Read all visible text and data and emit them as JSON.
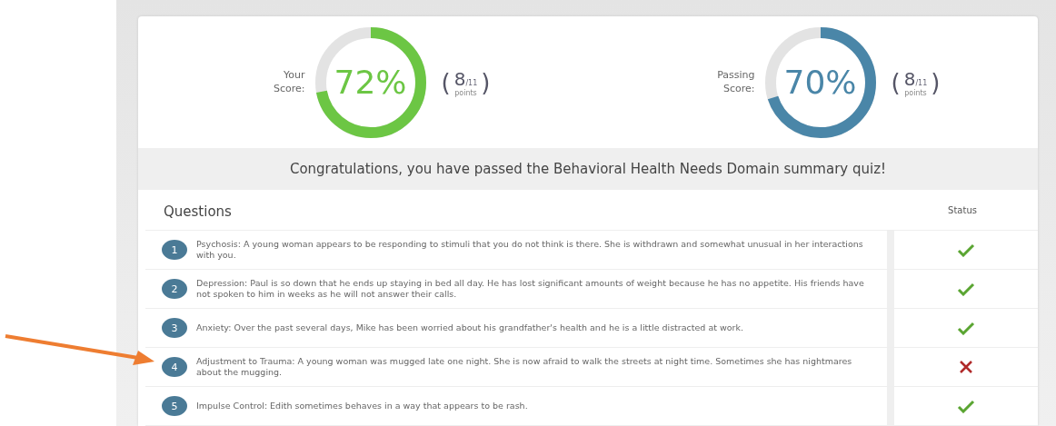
{
  "scores": [
    {
      "label": "Your Score:",
      "percent": "72%",
      "level": 0.72,
      "color": "#6cc644",
      "paren_open": "(",
      "earned": "8",
      "total": "/11",
      "unit": "points",
      "paren_close": ")"
    },
    {
      "label": "Passing Score:",
      "percent": "70%",
      "level": 0.7,
      "color": "#4a86a8",
      "paren_open": "(",
      "earned": "8",
      "total": "/11",
      "unit": "points",
      "paren_close": ")"
    }
  ],
  "message": "Congratulations, you have passed the Behavioral Health Needs Domain summary quiz!",
  "table": {
    "columns": [
      "Questions",
      "Status"
    ],
    "rows": [
      {
        "number": "1",
        "text": "Psychosis: A young woman appears to be responding to stimuli that you do not think is there. She is withdrawn and somewhat unusual in her interactions with you.",
        "correct": true
      },
      {
        "number": "2",
        "text": "Depression: Paul is so down that he ends up staying in bed all day. He has lost significant amounts of weight because he has no appetite. His friends have not spoken to him in weeks as he will not answer their calls.",
        "correct": true
      },
      {
        "number": "3",
        "text": "Anxiety: Over the past several days, Mike has been worried about his grandfather's health and he is a little distracted at work.",
        "correct": true
      },
      {
        "number": "4",
        "text": "Adjustment to Trauma: A young woman was mugged late one night. She is now afraid to walk the streets at night time. Sometimes she has nightmares about the mugging.",
        "correct": false
      },
      {
        "number": "5",
        "text": "Impulse Control: Edith sometimes behaves in a way that appears to be rash.",
        "correct": true
      }
    ]
  },
  "annotation": {
    "kind": "arrow",
    "color": "#ee7d31"
  }
}
